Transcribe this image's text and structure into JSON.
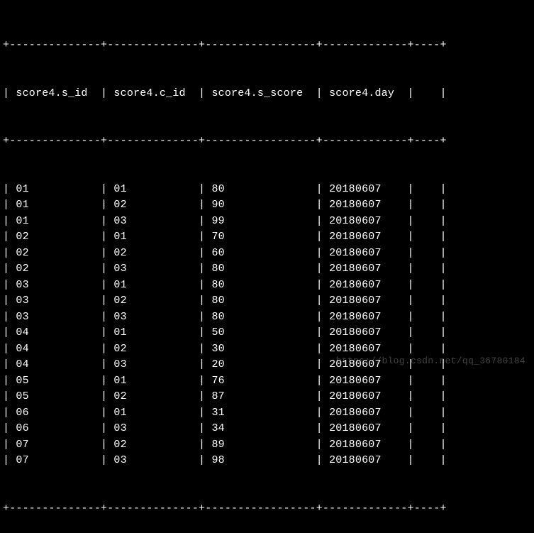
{
  "table": {
    "columns": [
      {
        "name": "score4.s_id",
        "width": 14
      },
      {
        "name": "score4.c_id",
        "width": 14
      },
      {
        "name": "score4.s_score",
        "width": 17
      },
      {
        "name": "score4.day",
        "width": 13
      },
      {
        "name": "",
        "width": 4
      }
    ],
    "rows": [
      {
        "s_id": "01",
        "c_id": "01",
        "s_score": "80",
        "day": "20180607"
      },
      {
        "s_id": "01",
        "c_id": "02",
        "s_score": "90",
        "day": "20180607"
      },
      {
        "s_id": "01",
        "c_id": "03",
        "s_score": "99",
        "day": "20180607"
      },
      {
        "s_id": "02",
        "c_id": "01",
        "s_score": "70",
        "day": "20180607"
      },
      {
        "s_id": "02",
        "c_id": "02",
        "s_score": "60",
        "day": "20180607"
      },
      {
        "s_id": "02",
        "c_id": "03",
        "s_score": "80",
        "day": "20180607"
      },
      {
        "s_id": "03",
        "c_id": "01",
        "s_score": "80",
        "day": "20180607"
      },
      {
        "s_id": "03",
        "c_id": "02",
        "s_score": "80",
        "day": "20180607"
      },
      {
        "s_id": "03",
        "c_id": "03",
        "s_score": "80",
        "day": "20180607"
      },
      {
        "s_id": "04",
        "c_id": "01",
        "s_score": "50",
        "day": "20180607"
      },
      {
        "s_id": "04",
        "c_id": "02",
        "s_score": "30",
        "day": "20180607"
      },
      {
        "s_id": "04",
        "c_id": "03",
        "s_score": "20",
        "day": "20180607"
      },
      {
        "s_id": "05",
        "c_id": "01",
        "s_score": "76",
        "day": "20180607"
      },
      {
        "s_id": "05",
        "c_id": "02",
        "s_score": "87",
        "day": "20180607"
      },
      {
        "s_id": "06",
        "c_id": "01",
        "s_score": "31",
        "day": "20180607"
      },
      {
        "s_id": "06",
        "c_id": "03",
        "s_score": "34",
        "day": "20180607"
      },
      {
        "s_id": "07",
        "c_id": "02",
        "s_score": "89",
        "day": "20180607"
      },
      {
        "s_id": "07",
        "c_id": "03",
        "s_score": "98",
        "day": "20180607"
      }
    ]
  },
  "watermark": "https://blog.csdn.net/qq_36780184"
}
